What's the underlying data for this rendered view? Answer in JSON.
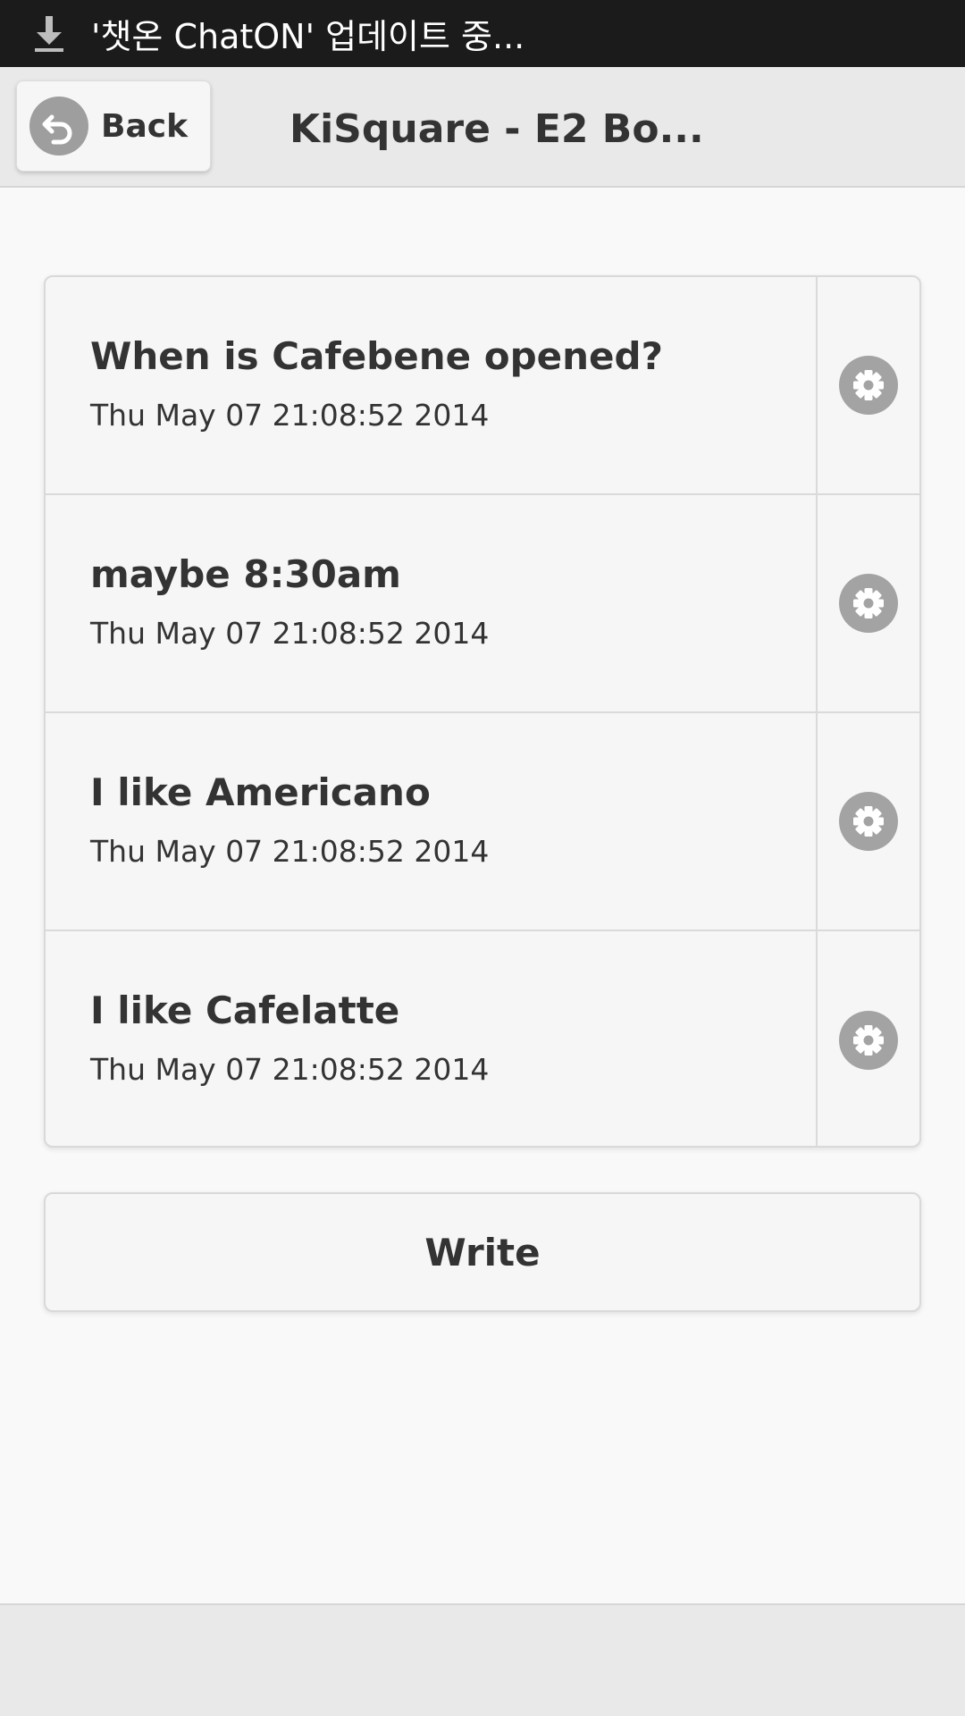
{
  "status_bar": {
    "notification_icon": "download-icon",
    "notification_text": "'챗온 ChatON' 업데이트 중..."
  },
  "header": {
    "back_label": "Back",
    "back_icon": "undo-arrow-icon",
    "title": "KiSquare - E2 Bo..."
  },
  "posts": [
    {
      "title": "When is Cafebene opened?",
      "date": "Thu May 07 21:08:52 2014",
      "icon": "gear-icon"
    },
    {
      "title": "maybe 8:30am",
      "date": "Thu May 07 21:08:52 2014",
      "icon": "gear-icon"
    },
    {
      "title": "I like Americano",
      "date": "Thu May 07 21:08:52 2014",
      "icon": "gear-icon"
    },
    {
      "title": "I like Cafelatte",
      "date": "Thu May 07 21:08:52 2014",
      "icon": "gear-icon"
    }
  ],
  "write_button": {
    "label": "Write"
  },
  "colors": {
    "status_bar_bg": "#1b1b1b",
    "header_bg": "#e9e9e9",
    "page_bg": "#f9f9f9",
    "icon_gray": "#9e9e9e",
    "text": "#333333"
  }
}
